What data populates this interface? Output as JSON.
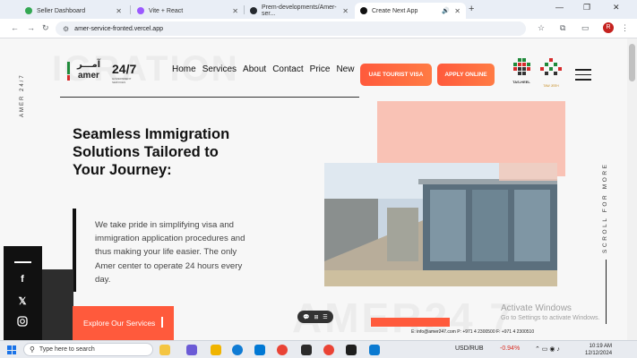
{
  "browser": {
    "tabs": [
      {
        "title": "Seller Dashboard",
        "favicon_color": "#34a853"
      },
      {
        "title": "Vite + React",
        "favicon_color": "#9b59ff"
      },
      {
        "title": "Prem-developments/Amer-ser...",
        "favicon_color": "#24292e"
      },
      {
        "title": "Create Next App",
        "favicon_color": "#111111"
      }
    ],
    "url": "amer-service-fronted.vercel.app",
    "profile_initial": "R"
  },
  "page": {
    "bg_word_top": "IGRATION",
    "bg_word_bottom": "AMER24 7",
    "side_text_left": "AMER 24/7",
    "side_text_right": "SCROLL FOR MORE",
    "logo": {
      "arabic": "آمـــر",
      "english": "amer",
      "number": "24/7",
      "subtitle": "GOVERNMENT SERVICES"
    },
    "nav": [
      "Home",
      "Services",
      "About",
      "Contact",
      "Price",
      "New"
    ],
    "buttons": {
      "uae_visa": "UAE TOURIST VISA",
      "apply_online": "APPLY ONLINE"
    },
    "partners": [
      {
        "label": "TAS-HEEL",
        "arabic": "تسهيل"
      },
      {
        "label": "TAW JEEH",
        "arabic": "توجيه"
      }
    ],
    "heading": "Seamless Immigration Solutions Tailored to Your Journey:",
    "paragraph": "We take pride in simplifying visa and immigration application procedures and thus making your life easier. The only Amer center to operate 24 hours every day.",
    "explore_button": "Explore Our Services",
    "contact_strip": "E: info@amer247.com P: +971 4 2300500 F: +971 4 2300510",
    "activate_title": "Activate Windows",
    "activate_sub": "Go to Settings to activate Windows.",
    "social_icons": [
      "facebook-icon",
      "x-icon",
      "instagram-icon"
    ]
  },
  "taskbar": {
    "search_placeholder": "Type here to search",
    "ticker": "USD/RUB",
    "ticker_change": "-0.94%",
    "time": "10:19 AM",
    "date": "12/12/2024",
    "ticker_color": "#d93025"
  }
}
